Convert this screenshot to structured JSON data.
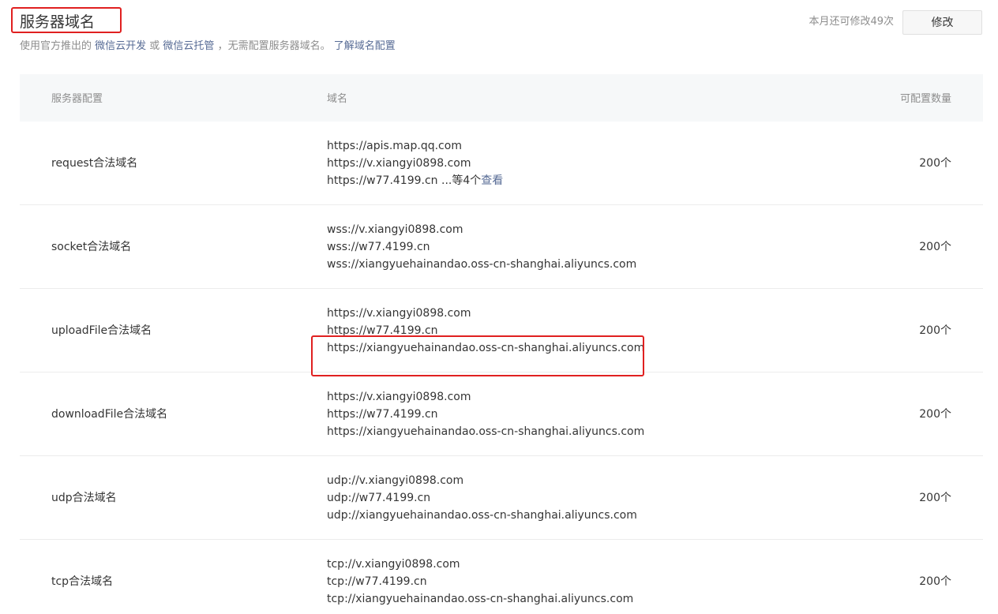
{
  "header": {
    "title": "服务器域名",
    "subtitle_prefix": "使用官方推出的 ",
    "link_weixin_dev": "微信云开发",
    "or_text": " 或 ",
    "link_weixin_hosting": "微信云托管",
    "subtitle_suffix": " ，无需配置服务器域名。 ",
    "link_learn": "了解域名配置",
    "remaining_text": "本月还可修改49次",
    "edit_button": "修改"
  },
  "table": {
    "columns": [
      "服务器配置",
      "域名",
      "可配置数量"
    ],
    "rows": [
      {
        "name": "request合法域名",
        "domains": [
          "https://apis.map.qq.com",
          "https://v.xiangyi0898.com",
          "https://w77.4199.cn"
        ],
        "more_text": " ...等4个",
        "more_link": "查看",
        "count": "200个"
      },
      {
        "name": "socket合法域名",
        "domains": [
          "wss://v.xiangyi0898.com",
          "wss://w77.4199.cn",
          "wss://xiangyuehainandao.oss-cn-shanghai.aliyuncs.com"
        ],
        "count": "200个"
      },
      {
        "name": "uploadFile合法域名",
        "domains": [
          "https://v.xiangyi0898.com",
          "https://w77.4199.cn",
          "https://xiangyuehainandao.oss-cn-shanghai.aliyuncs.com"
        ],
        "count": "200个"
      },
      {
        "name": "downloadFile合法域名",
        "domains": [
          "https://v.xiangyi0898.com",
          "https://w77.4199.cn",
          "https://xiangyuehainandao.oss-cn-shanghai.aliyuncs.com"
        ],
        "count": "200个"
      },
      {
        "name": "udp合法域名",
        "domains": [
          "udp://v.xiangyi0898.com",
          "udp://w77.4199.cn",
          "udp://xiangyuehainandao.oss-cn-shanghai.aliyuncs.com"
        ],
        "count": "200个"
      },
      {
        "name": "tcp合法域名",
        "domains": [
          "tcp://v.xiangyi0898.com",
          "tcp://w77.4199.cn",
          "tcp://xiangyuehainandao.oss-cn-shanghai.aliyuncs.com"
        ],
        "count": "200个"
      }
    ]
  },
  "colors": {
    "link": "#576b95",
    "annotation": "#e02020",
    "header_bg": "#f6f8f9"
  }
}
